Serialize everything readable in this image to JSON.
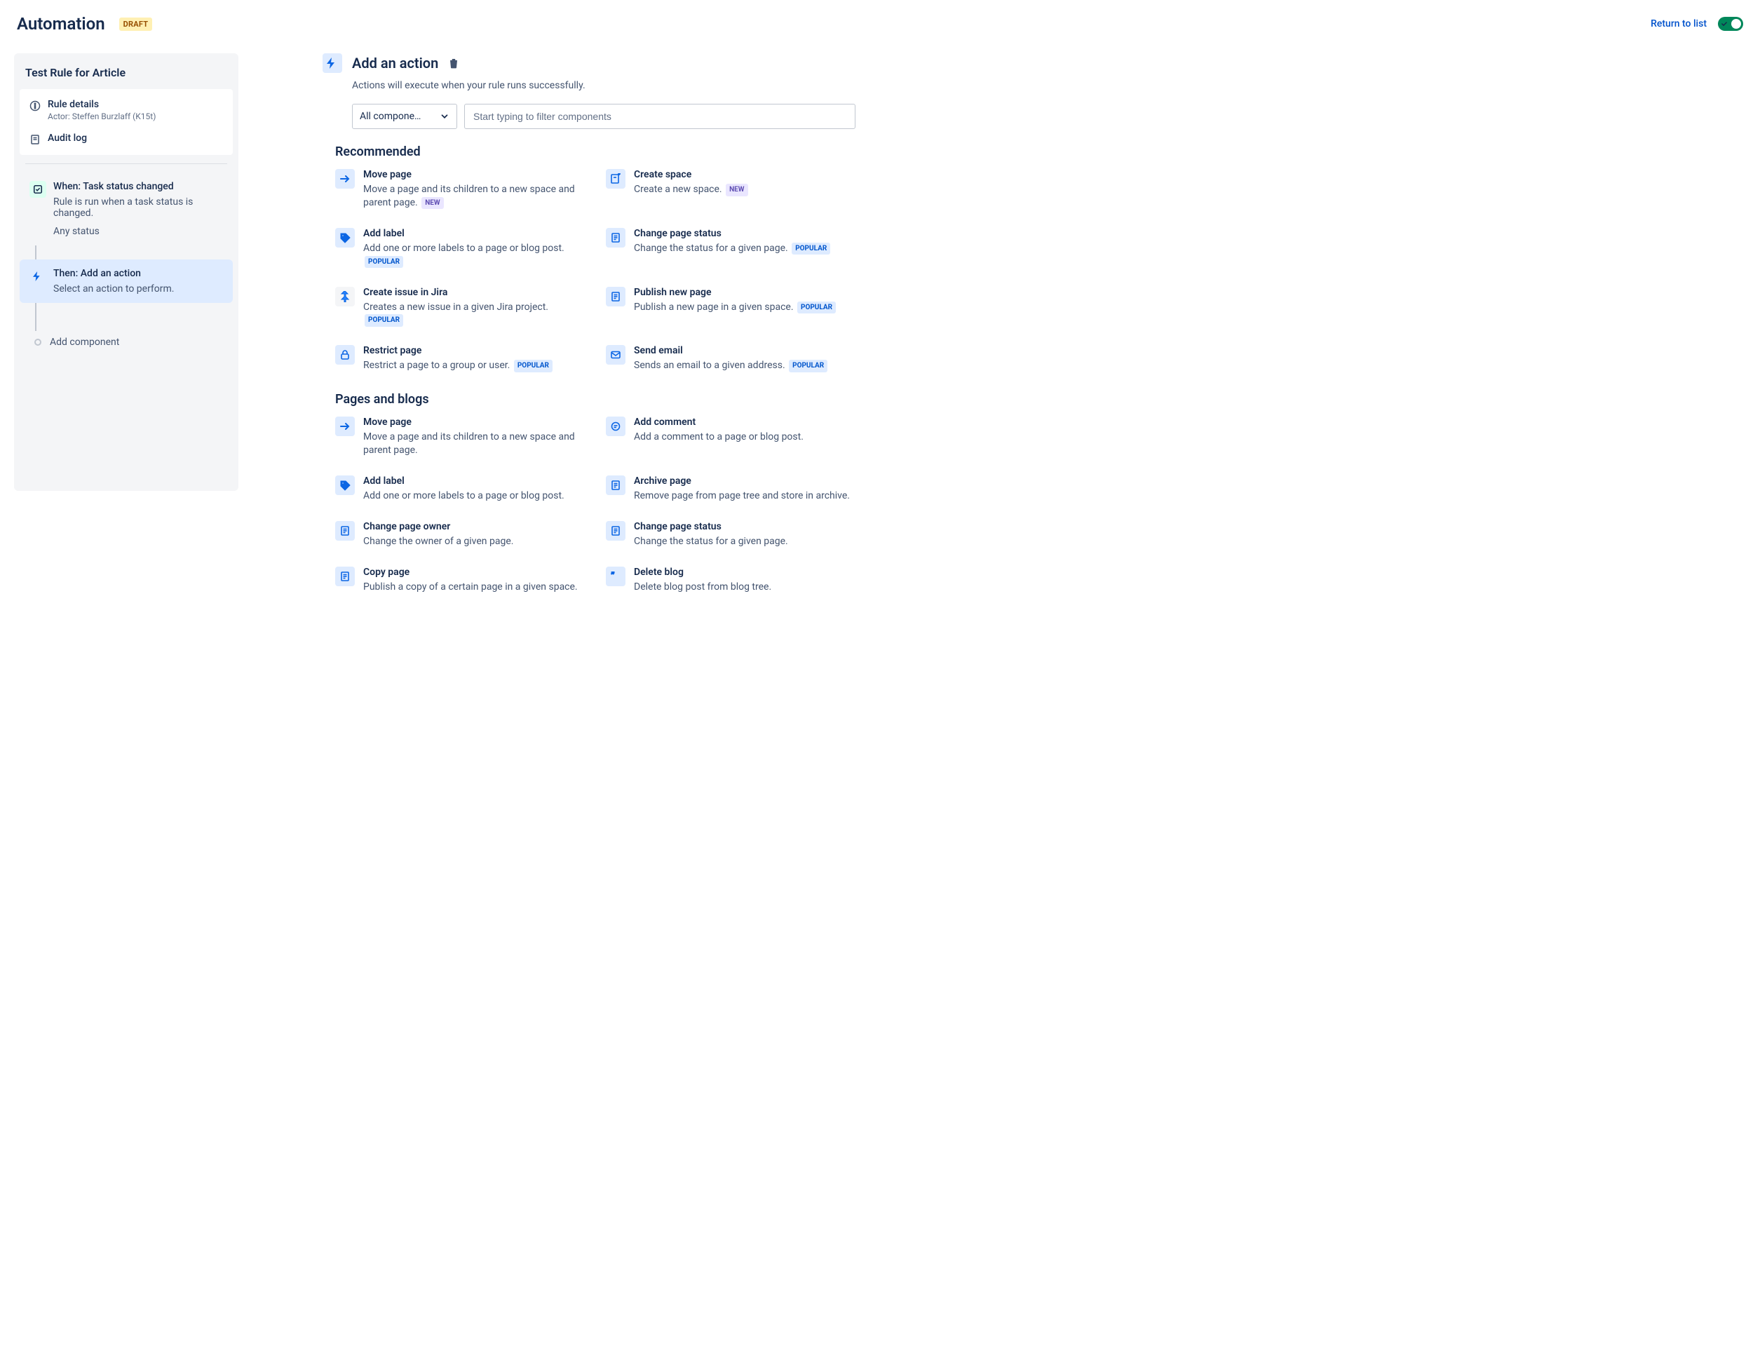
{
  "header": {
    "title": "Automation",
    "status_badge": "DRAFT",
    "return_link": "Return to list"
  },
  "rule_panel": {
    "title": "Test Rule for Article",
    "rule_details_label": "Rule details",
    "actor_label": "Actor: Steffen Burzlaff (K15t)",
    "audit_log_label": "Audit log",
    "trigger": {
      "title": "When: Task status changed",
      "description": "Rule is run when a task status is changed.",
      "extra": "Any status"
    },
    "action": {
      "title": "Then: Add an action",
      "description": "Select an action to perform."
    },
    "add_component_label": "Add component"
  },
  "main": {
    "heading": "Add an action",
    "subheading": "Actions will execute when your rule runs successfully.",
    "select_label": "All compone…",
    "search_placeholder": "Start typing to filter components",
    "sections": [
      {
        "title": "Recommended",
        "cards": [
          {
            "icon": "arrow-right",
            "title": "Move page",
            "desc": "Move a page and its children to a new space and parent page.",
            "badge": "NEW"
          },
          {
            "icon": "page-plus",
            "title": "Create space",
            "desc": "Create a new space.",
            "badge": "NEW"
          },
          {
            "icon": "tag",
            "title": "Add label",
            "desc": "Add one or more labels to a page or blog post.",
            "badge": "POPULAR"
          },
          {
            "icon": "page",
            "title": "Change page status",
            "desc": "Change the status for a given page.",
            "badge": "POPULAR"
          },
          {
            "icon": "jira",
            "title": "Create issue in Jira",
            "desc": "Creates a new issue in a given Jira project.",
            "badge": "POPULAR"
          },
          {
            "icon": "page",
            "title": "Publish new page",
            "desc": "Publish a new page in a given space.",
            "badge": "POPULAR"
          },
          {
            "icon": "lock",
            "title": "Restrict page",
            "desc": "Restrict a page to a group or user.",
            "badge": "POPULAR"
          },
          {
            "icon": "mail",
            "title": "Send email",
            "desc": "Sends an email to a given address.",
            "badge": "POPULAR"
          }
        ]
      },
      {
        "title": "Pages and blogs",
        "cards": [
          {
            "icon": "arrow-right",
            "title": "Move page",
            "desc": "Move a page and its children to a new space and parent page."
          },
          {
            "icon": "bubble",
            "title": "Add comment",
            "desc": "Add a comment to a page or blog post."
          },
          {
            "icon": "tag",
            "title": "Add label",
            "desc": "Add one or more labels to a page or blog post."
          },
          {
            "icon": "page",
            "title": "Archive page",
            "desc": "Remove page from page tree and store in archive."
          },
          {
            "icon": "page",
            "title": "Change page owner",
            "desc": "Change the owner of a given page."
          },
          {
            "icon": "page",
            "title": "Change page status",
            "desc": "Change the status for a given page."
          },
          {
            "icon": "page",
            "title": "Copy page",
            "desc": "Publish a copy of a certain page in a given space."
          },
          {
            "icon": "quote",
            "title": "Delete blog",
            "desc": "Delete blog post from blog tree."
          }
        ]
      }
    ]
  }
}
